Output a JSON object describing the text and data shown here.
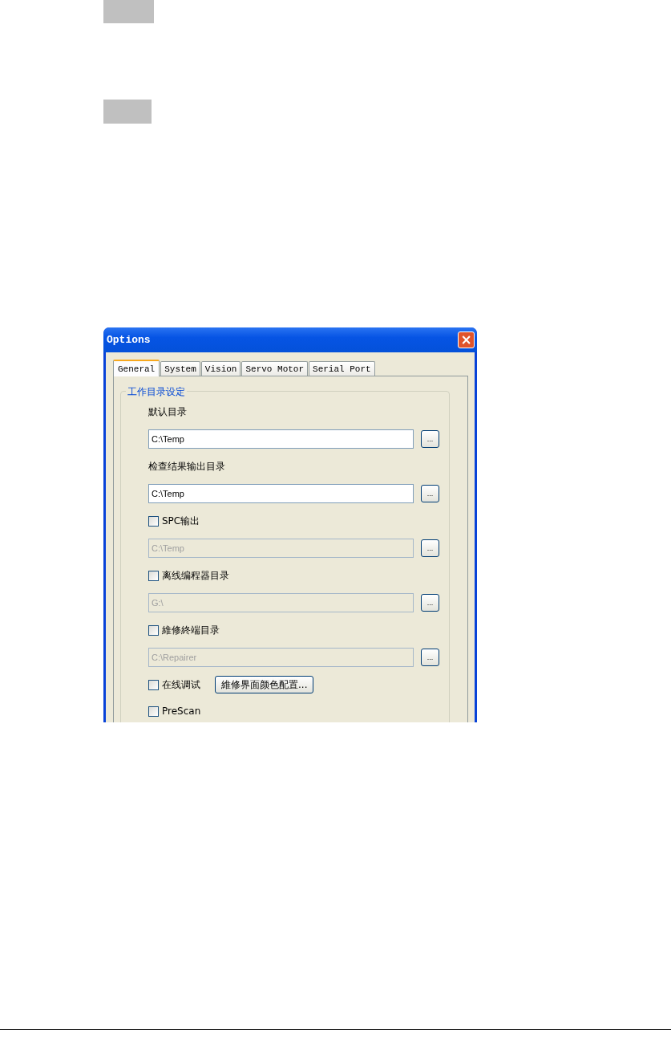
{
  "window": {
    "title": "Options",
    "close": "×"
  },
  "tabs": [
    {
      "label": "General",
      "selected": true
    },
    {
      "label": "System",
      "selected": false
    },
    {
      "label": "Vision",
      "selected": false
    },
    {
      "label": "Servo Motor",
      "selected": false
    },
    {
      "label": "Serial Port",
      "selected": false
    }
  ],
  "group": {
    "title": "工作目录设定",
    "items": [
      {
        "kind": "label",
        "text": "默认目录"
      },
      {
        "kind": "path",
        "value": "C:\\Temp",
        "disabled": false,
        "browse": "..."
      },
      {
        "kind": "label",
        "text": "检查结果输出目录"
      },
      {
        "kind": "path",
        "value": "C:\\Temp",
        "disabled": false,
        "browse": "..."
      },
      {
        "kind": "checkbox",
        "label": "SPC输出",
        "checked": false
      },
      {
        "kind": "path",
        "value": "C:\\Temp",
        "disabled": true,
        "browse": "..."
      },
      {
        "kind": "checkbox",
        "label": "离线编程器目录",
        "checked": false
      },
      {
        "kind": "path",
        "value": "G:\\",
        "disabled": true,
        "browse": "..."
      },
      {
        "kind": "checkbox",
        "label": "維修終端目录",
        "checked": false
      },
      {
        "kind": "path",
        "value": "C:\\Repairer",
        "disabled": true,
        "browse": "..."
      },
      {
        "kind": "checkbox",
        "label": "在线调试",
        "checked": false,
        "button": "維修界面颜色配置..."
      },
      {
        "kind": "checkbox",
        "label": "PreScan",
        "checked": false
      }
    ]
  }
}
